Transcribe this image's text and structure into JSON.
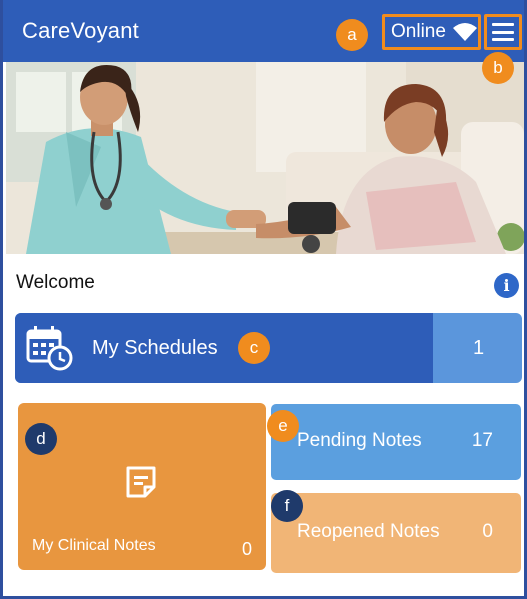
{
  "header": {
    "app_title": "CareVoyant",
    "status_text": "Online",
    "wifi_icon": "wifi-icon",
    "menu_icon": "hamburger-menu-icon"
  },
  "callouts": {
    "a": "a",
    "b": "b",
    "c": "c",
    "d": "d",
    "e": "e",
    "f": "f"
  },
  "hero": {
    "alt": "nurse-with-patient-photo"
  },
  "welcome": {
    "text": "Welcome",
    "info_icon": "i"
  },
  "tiles": {
    "schedules": {
      "label": "My Schedules",
      "count": "1",
      "icon": "calendar-clock-icon"
    },
    "clinical_notes": {
      "label": "My Clinical Notes",
      "count": "0",
      "icon": "note-icon"
    },
    "pending_notes": {
      "label": "Pending Notes",
      "count": "17"
    },
    "reopened_notes": {
      "label": "Reopened Notes",
      "count": "0"
    }
  },
  "colors": {
    "header": "#2e5db8",
    "callout_orange": "#f08c1e",
    "callout_navy": "#1f3a6b",
    "schedules": "#2e5db8",
    "schedules_count": "#5b96dc",
    "clinical": "#e8963f",
    "pending": "#5b9fdf",
    "reopened": "#f1b576"
  }
}
